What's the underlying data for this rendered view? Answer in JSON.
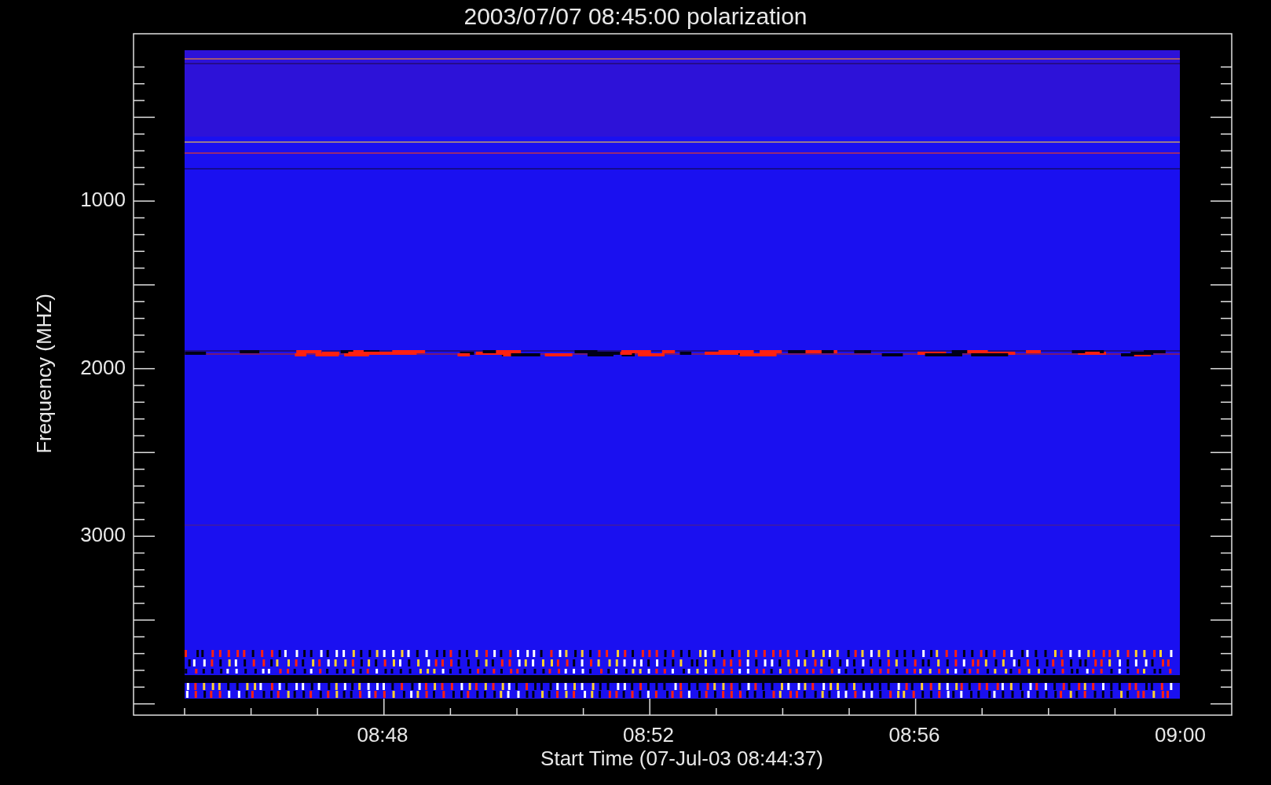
{
  "title": "2003/07/07 08:45:00 polarization",
  "y_axis": {
    "label": "Frequency (MHZ)",
    "ticks": [
      "1000",
      "2000",
      "3000"
    ]
  },
  "x_axis": {
    "label": "Start Time (07-Jul-03 08:44:37)",
    "ticks": [
      "08:48",
      "08:52",
      "08:56",
      "09:00"
    ]
  }
}
